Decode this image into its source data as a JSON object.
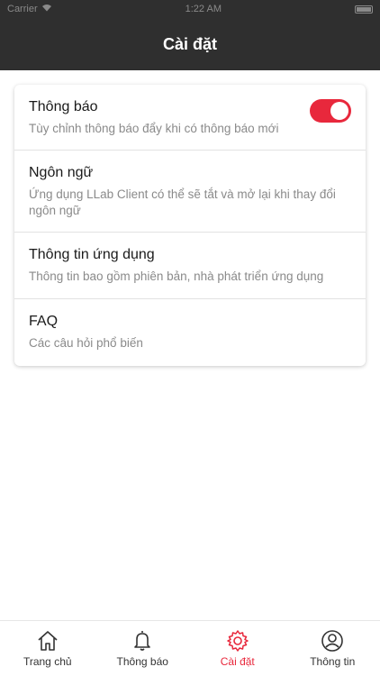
{
  "status_bar": {
    "carrier": "Carrier",
    "time": "1:22 AM"
  },
  "header": {
    "title": "Cài đặt"
  },
  "settings": [
    {
      "title": "Thông báo",
      "description": "Tùy chỉnh thông báo đẩy khi có thông báo mới",
      "toggle_on": true
    },
    {
      "title": "Ngôn ngữ",
      "description": "Ứng dụng LLab Client có thể sẽ tắt và mở lại khi thay đổi ngôn ngữ"
    },
    {
      "title": "Thông tin ứng dụng",
      "description": "Thông tin bao gồm phiên bản, nhà phát triển ứng dụng"
    },
    {
      "title": "FAQ",
      "description": "Các câu hỏi phổ biến"
    }
  ],
  "tabs": [
    {
      "label": "Trang chủ",
      "icon": "home-icon"
    },
    {
      "label": "Thông báo",
      "icon": "bell-icon"
    },
    {
      "label": "Cài đặt",
      "icon": "gear-icon",
      "active": true
    },
    {
      "label": "Thông tin",
      "icon": "user-icon"
    }
  ],
  "colors": {
    "accent": "#e8283c",
    "header_bg": "#2f2f2f"
  }
}
